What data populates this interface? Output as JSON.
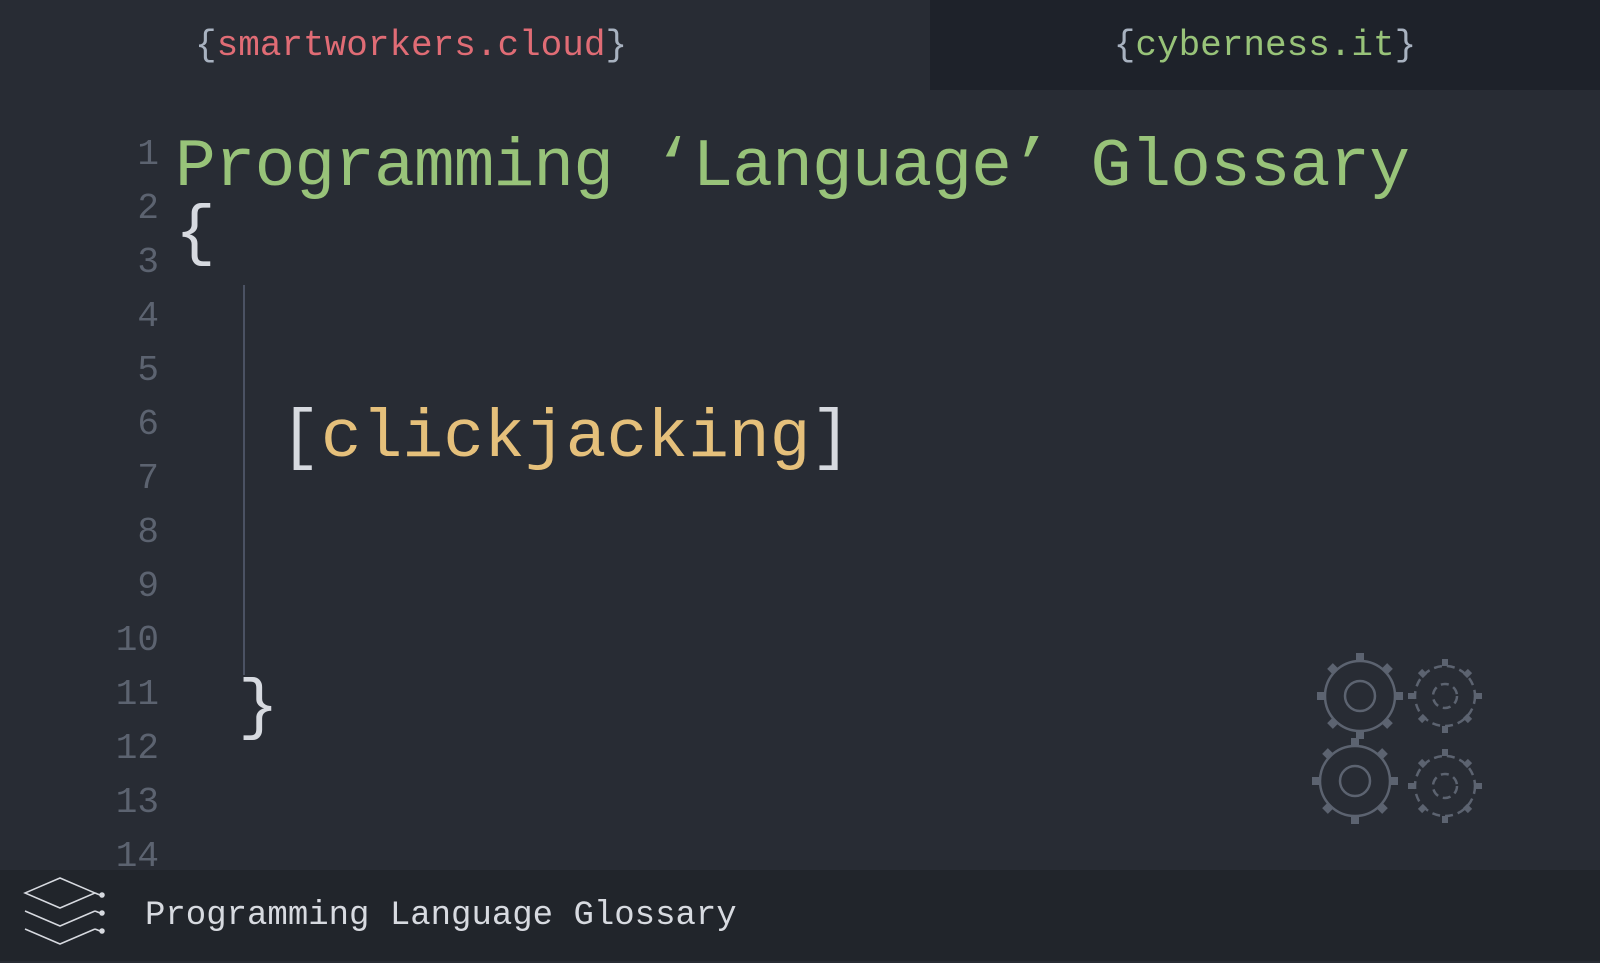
{
  "header": {
    "left_domain": "smartworkers.cloud",
    "right_domain": "cyberness.it"
  },
  "editor": {
    "line_numbers": [
      "1",
      "2",
      "3",
      "4",
      "5",
      "6",
      "7",
      "8",
      "9",
      "10",
      "11",
      "12",
      "13",
      "14"
    ],
    "title": "Programming ‘Language’ Glossary",
    "open_brace": "{",
    "close_brace": "}",
    "term": "clickjacking",
    "bracket_open": "[",
    "bracket_close": "]"
  },
  "footer": {
    "text": "Programming Language Glossary"
  }
}
